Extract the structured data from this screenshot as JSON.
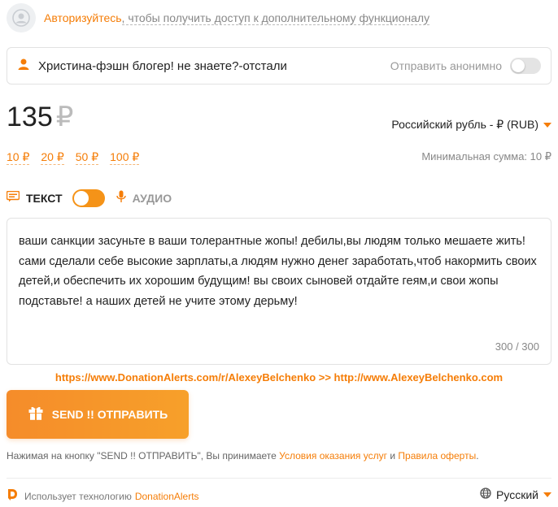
{
  "auth": {
    "link": "Авторизуйтесь",
    "rest": ", чтобы получить доступ к дополнительному функционалу"
  },
  "name_field": {
    "value": "Христина-фэшн блогер! не знаете?-отстали",
    "anon_label": "Отправить анонимно"
  },
  "amount": {
    "value": "135",
    "currency_symbol": "₽",
    "currency_select": "Российский рубль - ₽ (RUB)",
    "presets": [
      "10 ₽",
      "20 ₽",
      "50 ₽",
      "100 ₽"
    ],
    "min_sum": "Минимальная сумма: 10 ₽"
  },
  "mode": {
    "text_label": "ТЕКСТ",
    "audio_label": "АУДИО"
  },
  "message": {
    "text": "ваши санкции засуньте в ваши толерантные жопы! дебилы,вы людям только мешаете жить! сами сделали себе высокие зарплаты,а людям нужно денег заработать,чтоб накормить своих детей,и обеспечить их хорошим будущим! вы своих сыновей отдайте геям,и свои жопы подставьте! а наших детей не учите этому дерьму!",
    "counter": "300 / 300"
  },
  "overlay_links": "https://www.DonationAlerts.com/r/AlexeyBelchenko  >>  http://www.AlexeyBelchenko.com",
  "send_button": {
    "label": "SEND !! ОТПРАВИТЬ"
  },
  "terms": {
    "prefix": "Нажимая на кнопку \"SEND !! ОТПРАВИТЬ\", Вы принимаете ",
    "link1": "Условия оказания услуг",
    "mid": " и ",
    "link2": "Правила оферты",
    "suffix": "."
  },
  "footer": {
    "powered": "Использует технологию",
    "brand": "DonationAlerts",
    "language": "Русский"
  },
  "colors": {
    "accent": "#f57d07",
    "button_gradient": [
      "#f58c2a",
      "#f7a02a"
    ]
  }
}
